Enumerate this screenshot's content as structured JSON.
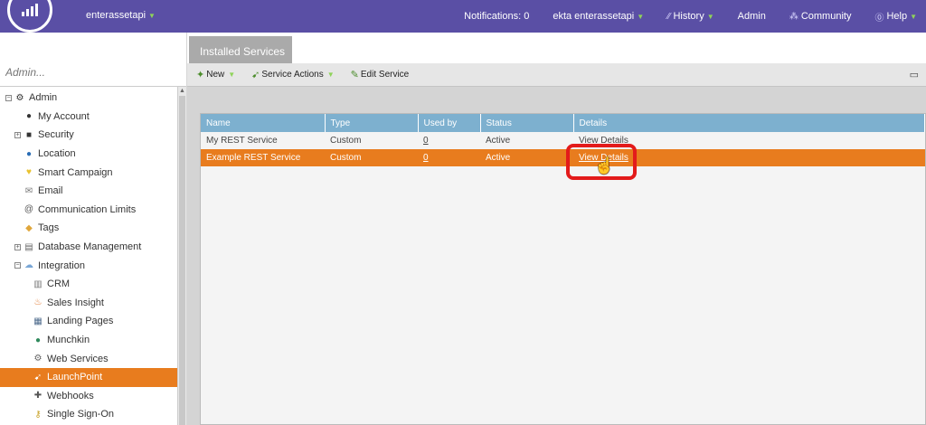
{
  "topbar": {
    "workspace": "enterassetapi",
    "notifications": "Notifications: 0",
    "user": "ekta enterassetapi",
    "history": "History",
    "admin": "Admin",
    "community": "Community",
    "help": "Help"
  },
  "sidebar": {
    "search_placeholder": "Admin...",
    "items": [
      {
        "label": "Admin",
        "icon": "gear-icon"
      },
      {
        "label": "My Account",
        "icon": "person-icon"
      },
      {
        "label": "Security",
        "icon": "lock-icon"
      },
      {
        "label": "Location",
        "icon": "globe-icon"
      },
      {
        "label": "Smart Campaign",
        "icon": "lightbulb-icon"
      },
      {
        "label": "Email",
        "icon": "email-icon"
      },
      {
        "label": "Communication Limits",
        "icon": "at-icon"
      },
      {
        "label": "Tags",
        "icon": "tag-icon"
      },
      {
        "label": "Database Management",
        "icon": "database-icon"
      },
      {
        "label": "Integration",
        "icon": "cloud-icon"
      },
      {
        "label": "CRM",
        "icon": "crm-icon"
      },
      {
        "label": "Sales Insight",
        "icon": "flame-icon"
      },
      {
        "label": "Landing Pages",
        "icon": "page-icon"
      },
      {
        "label": "Munchkin",
        "icon": "munchkin-icon"
      },
      {
        "label": "Web Services",
        "icon": "web-services-icon"
      },
      {
        "label": "LaunchPoint",
        "icon": "launchpoint-icon"
      },
      {
        "label": "Webhooks",
        "icon": "webhook-icon"
      },
      {
        "label": "Single Sign-On",
        "icon": "key-icon"
      }
    ]
  },
  "main": {
    "tab": "Installed Services",
    "toolbar": {
      "new": "New",
      "service_actions": "Service Actions",
      "edit_service": "Edit Service"
    },
    "table": {
      "headers": [
        "Name",
        "Type",
        "Used by",
        "Status",
        "Details"
      ],
      "rows": [
        [
          "My REST Service",
          "Custom",
          "0",
          "Active",
          "View Details"
        ],
        [
          "Example REST Service",
          "Custom",
          "0",
          "Active",
          "View Details"
        ]
      ]
    }
  },
  "colors": {
    "topbar": "#5a4fa5",
    "accent": "#e87c1e",
    "header": "#7db0cf",
    "highlight": "#e31b1b"
  }
}
